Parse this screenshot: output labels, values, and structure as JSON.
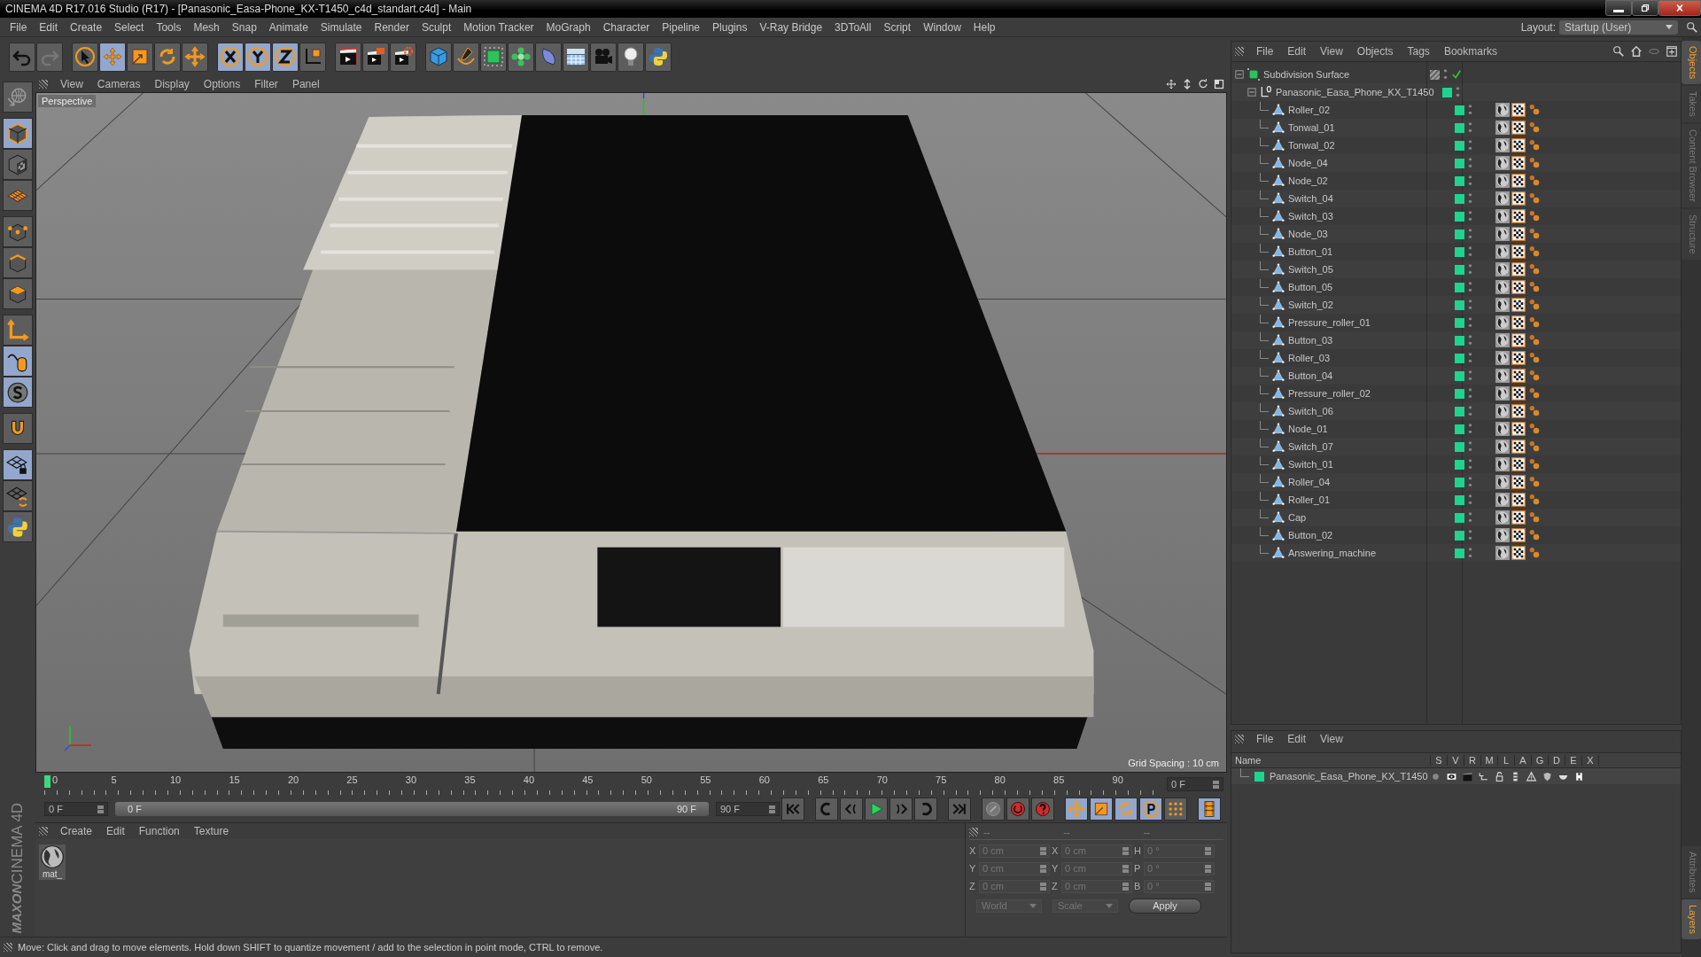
{
  "window": {
    "title": "CINEMA 4D R17.016 Studio (R17) - [Panasonic_Easa-Phone_KX-T1450_c4d_standart.c4d] - Main"
  },
  "menu": [
    "File",
    "Edit",
    "Create",
    "Select",
    "Tools",
    "Mesh",
    "Snap",
    "Animate",
    "Simulate",
    "Render",
    "Sculpt",
    "Motion Tracker",
    "MoGraph",
    "Character",
    "Pipeline",
    "Plugins",
    "V-Ray Bridge",
    "3DToAll",
    "Script",
    "Window",
    "Help"
  ],
  "layout": {
    "label": "Layout:",
    "value": "Startup (User)"
  },
  "toolbar": [
    {
      "kind": "undo",
      "active": false
    },
    {
      "kind": "redo",
      "active": false
    },
    {
      "kind": "select",
      "active": false
    },
    {
      "kind": "move",
      "active": true
    },
    {
      "kind": "scale",
      "active": false
    },
    {
      "kind": "rotate",
      "active": false
    },
    {
      "kind": "transform",
      "active": false
    },
    {
      "kind": "axis-x",
      "active": true
    },
    {
      "kind": "axis-y",
      "active": true
    },
    {
      "kind": "axis-z",
      "active": true
    },
    {
      "kind": "coord",
      "active": false
    },
    {
      "kind": "render-view",
      "active": false
    },
    {
      "kind": "render",
      "active": false
    },
    {
      "kind": "render-settings",
      "active": false
    },
    {
      "kind": "cube",
      "active": false
    },
    {
      "kind": "pen",
      "active": false
    },
    {
      "kind": "subdiv",
      "active": false
    },
    {
      "kind": "array",
      "active": false
    },
    {
      "kind": "deformer",
      "active": false
    },
    {
      "kind": "floor",
      "active": false
    },
    {
      "kind": "camera",
      "active": false
    },
    {
      "kind": "light",
      "active": false
    },
    {
      "kind": "python",
      "active": false
    }
  ],
  "tool_palette": [
    {
      "kind": "view-mode",
      "active": false
    },
    {
      "kind": "model",
      "active": true
    },
    {
      "kind": "texture",
      "active": false
    },
    {
      "kind": "workplane",
      "active": false
    },
    {
      "kind": "points",
      "active": false
    },
    {
      "kind": "edges",
      "active": false
    },
    {
      "kind": "polygons",
      "active": false
    },
    {
      "kind": "axis",
      "active": false
    },
    {
      "kind": "tweak",
      "active": true
    },
    {
      "kind": "snap",
      "active": true
    },
    {
      "kind": "magnet",
      "active": false
    },
    {
      "kind": "lock-grid",
      "active": true
    },
    {
      "kind": "grid-rotate",
      "active": false
    },
    {
      "kind": "python",
      "active": false
    }
  ],
  "viewport": {
    "menu": [
      "View",
      "Cameras",
      "Display",
      "Options",
      "Filter",
      "Panel"
    ],
    "camera": "Perspective",
    "grid_spacing": "Grid Spacing : 10 cm"
  },
  "timeline": {
    "ticks": [
      "0",
      "5",
      "10",
      "15",
      "20",
      "25",
      "30",
      "35",
      "40",
      "45",
      "50",
      "55",
      "60",
      "65",
      "70",
      "75",
      "80",
      "85",
      "90"
    ],
    "current_frame": "0 F",
    "start": "0 F",
    "range": {
      "start": "0 F",
      "end": "90 F",
      "level": 1
    },
    "end": "90 F",
    "transport": [
      {
        "kind": "go-start",
        "active": false
      },
      {
        "kind": "prev-key",
        "active": false
      },
      {
        "kind": "prev-frame",
        "active": false
      },
      {
        "kind": "play",
        "active": false
      },
      {
        "kind": "next-frame",
        "active": false
      },
      {
        "kind": "next-key",
        "active": false
      },
      {
        "kind": "go-end",
        "active": false
      },
      {
        "kind": "key",
        "active": false
      },
      {
        "kind": "record",
        "active": false
      },
      {
        "kind": "autokey",
        "active": false
      },
      {
        "kind": "key-move",
        "active": true
      },
      {
        "kind": "key-scale",
        "active": true
      },
      {
        "kind": "key-rotate",
        "active": true
      },
      {
        "kind": "key-param",
        "active": true
      },
      {
        "kind": "key-points",
        "active": false
      },
      {
        "kind": "timeline",
        "active": true
      }
    ]
  },
  "materials": {
    "menu": [
      "Create",
      "Edit",
      "Function",
      "Texture"
    ],
    "items": [
      {
        "name": "mat_"
      }
    ]
  },
  "coordinates": {
    "headers": [
      "--",
      "--",
      "--"
    ],
    "rows": [
      [
        {
          "axis": "X",
          "value": "0 cm"
        },
        {
          "axis": "X",
          "value": "0 cm"
        },
        {
          "axis": "H",
          "value": "0 °"
        }
      ],
      [
        {
          "axis": "Y",
          "value": "0 cm"
        },
        {
          "axis": "Y",
          "value": "0 cm"
        },
        {
          "axis": "P",
          "value": "0 °"
        }
      ],
      [
        {
          "axis": "Z",
          "value": "0 cm"
        },
        {
          "axis": "Z",
          "value": "0 cm"
        },
        {
          "axis": "B",
          "value": "0 °"
        }
      ]
    ],
    "space": "World",
    "mode": "Scale",
    "apply": "Apply"
  },
  "objects": {
    "menu": [
      "File",
      "Edit",
      "View",
      "Objects",
      "Tags",
      "Bookmarks"
    ],
    "tree": [
      {
        "name": "Subdivision Surface",
        "kind": "subdivision",
        "expanded": true,
        "enabled": true,
        "children": [
          {
            "name": "Panasonic_Easa_Phone_KX_T1450",
            "kind": "null",
            "expanded": true,
            "color": "#1fd390",
            "children": [
              {
                "name": "Roller_02",
                "kind": "polygon",
                "color": "#1fd390"
              },
              {
                "name": "Tonwal_01",
                "kind": "polygon",
                "color": "#1fd390"
              },
              {
                "name": "Tonwal_02",
                "kind": "polygon",
                "color": "#1fd390"
              },
              {
                "name": "Node_04",
                "kind": "polygon",
                "color": "#1fd390"
              },
              {
                "name": "Node_02",
                "kind": "polygon",
                "color": "#1fd390"
              },
              {
                "name": "Switch_04",
                "kind": "polygon",
                "color": "#1fd390"
              },
              {
                "name": "Switch_03",
                "kind": "polygon",
                "color": "#1fd390"
              },
              {
                "name": "Node_03",
                "kind": "polygon",
                "color": "#1fd390"
              },
              {
                "name": "Button_01",
                "kind": "polygon",
                "color": "#1fd390"
              },
              {
                "name": "Switch_05",
                "kind": "polygon",
                "color": "#1fd390"
              },
              {
                "name": "Button_05",
                "kind": "polygon",
                "color": "#1fd390"
              },
              {
                "name": "Switch_02",
                "kind": "polygon",
                "color": "#1fd390"
              },
              {
                "name": "Pressure_roller_01",
                "kind": "polygon",
                "color": "#1fd390"
              },
              {
                "name": "Button_03",
                "kind": "polygon",
                "color": "#1fd390"
              },
              {
                "name": "Roller_03",
                "kind": "polygon",
                "color": "#1fd390"
              },
              {
                "name": "Button_04",
                "kind": "polygon",
                "color": "#1fd390"
              },
              {
                "name": "Pressure_roller_02",
                "kind": "polygon",
                "color": "#1fd390"
              },
              {
                "name": "Switch_06",
                "kind": "polygon",
                "color": "#1fd390"
              },
              {
                "name": "Node_01",
                "kind": "polygon",
                "color": "#1fd390"
              },
              {
                "name": "Switch_07",
                "kind": "polygon",
                "color": "#1fd390"
              },
              {
                "name": "Switch_01",
                "kind": "polygon",
                "color": "#1fd390"
              },
              {
                "name": "Roller_04",
                "kind": "polygon",
                "color": "#1fd390"
              },
              {
                "name": "Roller_01",
                "kind": "polygon",
                "color": "#1fd390"
              },
              {
                "name": "Cap",
                "kind": "polygon",
                "color": "#1fd390"
              },
              {
                "name": "Button_02",
                "kind": "polygon",
                "color": "#1fd390"
              },
              {
                "name": "Answering_machine",
                "kind": "polygon",
                "color": "#1fd390"
              }
            ]
          }
        ]
      }
    ]
  },
  "layers": {
    "menu": [
      "File",
      "Edit",
      "View"
    ],
    "columns": [
      "Name",
      "S",
      "V",
      "R",
      "M",
      "L",
      "A",
      "G",
      "D",
      "E",
      "X"
    ],
    "rows": [
      {
        "name": "Panasonic_Easa_Phone_KX_T1450",
        "color": "#1fd390"
      }
    ]
  },
  "side_tabs_top": [
    {
      "label": "Objects",
      "selected": true
    },
    {
      "label": "Takes",
      "selected": false
    },
    {
      "label": "Content Browser",
      "selected": false
    },
    {
      "label": "Structure",
      "selected": false
    }
  ],
  "side_tabs_bottom": [
    {
      "label": "Attributes",
      "selected": false
    },
    {
      "label": "Layers",
      "selected": true
    }
  ],
  "logo": {
    "brand": "MAXON",
    "product": "CINEMA 4D"
  },
  "status_bar": "Move: Click and drag to move elements. Hold down SHIFT to quantize movement / add to the selection in point mode, CTRL to remove."
}
